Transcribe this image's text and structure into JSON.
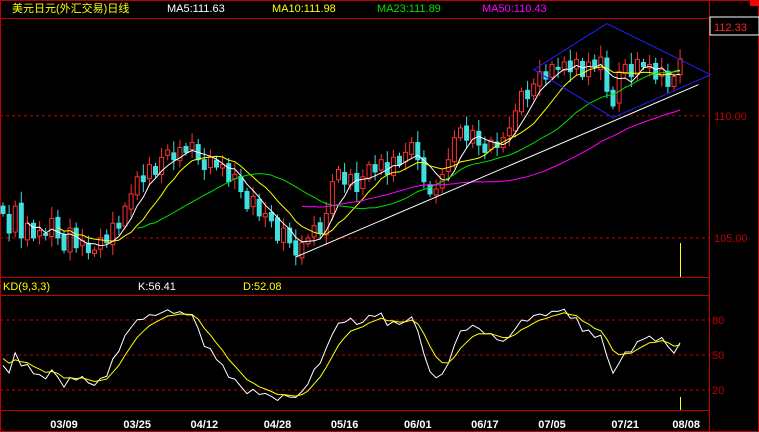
{
  "title": "美元日元(外汇交易)日线",
  "indicators": {
    "ma5": "MA5:111.63",
    "ma10": "MA10:111.98",
    "ma23": "MA23:111.89",
    "ma50": "MA50:110.43"
  },
  "current_price": "112.33",
  "price_axis_labels": [
    "110.00",
    "105.00"
  ],
  "kd": {
    "title": "KD(9,3,3)",
    "k": "K:56.41",
    "d": "D:52.08",
    "axis_labels": [
      "80",
      "50",
      "20"
    ]
  },
  "colors": {
    "up": "#ff3030",
    "down": "#40e0e0",
    "ma5": "#ffffff",
    "ma10": "#ffff00",
    "ma23": "#00e000",
    "ma50": "#ff00ff",
    "border": "#c00000",
    "trend_support": "#ffffff",
    "trend_channel": "#2020ff"
  },
  "chart_data": {
    "type": "candlestick",
    "title": "美元日元(外汇交易)日线",
    "ylim": [
      103.4,
      114.0
    ],
    "y_gridlines": [
      110,
      105
    ],
    "x_ticks": [
      {
        "label": "03/09",
        "index": 10
      },
      {
        "label": "03/25",
        "index": 22
      },
      {
        "label": "04/12",
        "index": 33
      },
      {
        "label": "04/28",
        "index": 45
      },
      {
        "label": "05/16",
        "index": 56
      },
      {
        "label": "06/01",
        "index": 68
      },
      {
        "label": "06/17",
        "index": 79
      },
      {
        "label": "07/05",
        "index": 90
      },
      {
        "label": "07/21",
        "index": 102
      },
      {
        "label": "08/08",
        "index": 112
      }
    ],
    "close": [
      106.0,
      105.2,
      106.3,
      105.0,
      105.6,
      105.0,
      105.3,
      105.1,
      105.8,
      105.0,
      104.5,
      105.4,
      104.6,
      104.9,
      104.4,
      104.5,
      105.0,
      104.8,
      105.6,
      105.4,
      106.3,
      106.8,
      107.5,
      107.3,
      108.0,
      107.6,
      108.3,
      108.6,
      108.2,
      108.7,
      108.5,
      108.9,
      108.2,
      107.8,
      108.3,
      107.9,
      108.0,
      107.3,
      107.6,
      106.9,
      106.2,
      106.7,
      105.9,
      106.0,
      105.7,
      104.9,
      105.4,
      104.8,
      104.3,
      104.8,
      105.0,
      105.5,
      105.2,
      106.0,
      107.3,
      107.8,
      107.2,
      107.6,
      106.9,
      107.5,
      108.0,
      107.7,
      108.2,
      107.6,
      108.3,
      108.0,
      108.5,
      108.9,
      108.2,
      107.3,
      106.8,
      107.0,
      107.6,
      108.2,
      109.1,
      109.5,
      109.0,
      109.4,
      108.8,
      108.5,
      109.0,
      108.7,
      109.1,
      109.5,
      110.2,
      111.0,
      110.7,
      111.3,
      111.8,
      111.5,
      112.1,
      111.9,
      112.2,
      111.8,
      112.3,
      111.6,
      112.2,
      112.0,
      112.4,
      111.0,
      110.4,
      111.8,
      112.1,
      111.6,
      112.3,
      112.0,
      112.1,
      111.5,
      111.9,
      111.2,
      111.6,
      112.33
    ],
    "moving_averages": [
      5,
      10,
      23,
      50
    ],
    "trend_lines": [
      {
        "name": "support",
        "points": [
          [
            48,
            104.22
          ],
          [
            114,
            111.27
          ]
        ]
      },
      {
        "name": "channel",
        "points": [
          [
            99,
            113.77
          ],
          [
            116,
            111.68
          ],
          [
            100,
            109.92
          ],
          [
            87,
            111.89
          ],
          [
            99,
            113.77
          ]
        ]
      }
    ],
    "kd_panel": {
      "type": "line",
      "params": [
        9,
        3,
        3
      ],
      "ylim": [
        0,
        100
      ],
      "y_gridlines": [
        80,
        50,
        20
      ],
      "series": [
        "K",
        "D"
      ]
    }
  }
}
